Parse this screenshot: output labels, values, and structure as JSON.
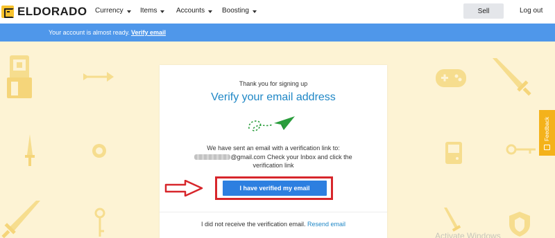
{
  "brand": {
    "name": "ELDORADO"
  },
  "nav": {
    "items": [
      {
        "label": "Currency"
      },
      {
        "label": "Items"
      },
      {
        "label": "Accounts"
      },
      {
        "label": "Boosting"
      }
    ],
    "sell_label": "Sell",
    "logout_label": "Log out"
  },
  "banner": {
    "text": "Your account is almost ready.",
    "link": "Verify email"
  },
  "card": {
    "subtitle": "Thank you for signing up",
    "title": "Verify your email address",
    "body_line1": "We have sent an email with a verification link to:",
    "email_visible": "@gmail.com",
    "body_line2": " Check your Inbox and click the verification link",
    "verified_button": "I have verified my email",
    "resend_text": "I did not receive the verification email.",
    "resend_link": "Resend email"
  },
  "feedback": {
    "label": "Feedback"
  },
  "watermark": {
    "text": "Activate Windows"
  },
  "colors": {
    "brand_yellow": "#f7c22e",
    "banner_blue": "#4f97ea",
    "title_blue": "#1f87c6",
    "button_blue": "#2d7fe0",
    "highlight_red": "#d7262b",
    "background_cream": "#fdf3d4",
    "feedback_orange": "#f4b21b",
    "plane_green": "#2a9d3c"
  },
  "icons": {
    "logo": "eldorado-logo-icon",
    "plane": "paper-plane-icon",
    "annotation_arrow": "red-arrow-icon",
    "feedback": "feedback-icon"
  }
}
